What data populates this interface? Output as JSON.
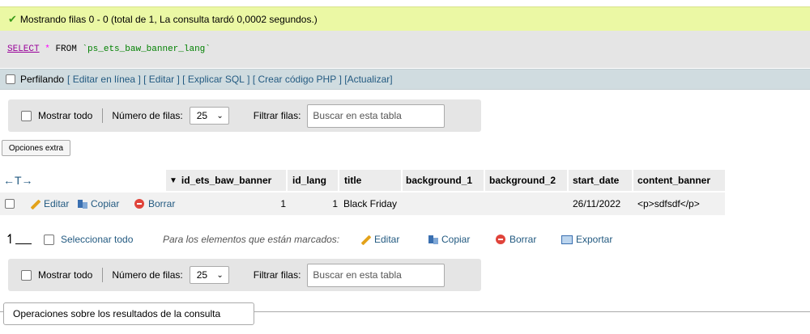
{
  "success_message": "Mostrando filas 0 - 0 (total de 1, La consulta tardó 0,0002 segundos.)",
  "sql": {
    "select": "SELECT",
    "star": "*",
    "from": "FROM",
    "table": "`ps_ets_baw_banner_lang`"
  },
  "profiling": {
    "label": "Perfilando",
    "links": [
      "Editar en línea",
      "Editar",
      "Explicar SQL",
      "Crear código PHP",
      "Actualizar"
    ]
  },
  "nav": {
    "show_all": "Mostrar todo",
    "rows_label": "Número de filas:",
    "rows_value": "25",
    "filter_label": "Filtrar filas:",
    "filter_placeholder": "Buscar en esta tabla"
  },
  "extra_options": "Opciones extra",
  "table": {
    "columns": [
      "id_ets_baw_banner",
      "id_lang",
      "title",
      "background_1",
      "background_2",
      "start_date",
      "content_banner"
    ],
    "row": {
      "actions": [
        "Editar",
        "Copiar",
        "Borrar"
      ],
      "id_ets_baw_banner": "1",
      "id_lang": "1",
      "title": "Black Friday",
      "background_1": "",
      "background_2": "",
      "start_date": "26/11/2022",
      "content_banner": "<p>sdfsdf</p>"
    }
  },
  "bulk": {
    "select_all": "Seleccionar todo",
    "marked_label": "Para los elementos que están marcados:",
    "edit": "Editar",
    "copy": "Copiar",
    "delete": "Borrar",
    "export": "Exportar"
  },
  "operations_title": "Operaciones sobre los resultados de la consulta"
}
